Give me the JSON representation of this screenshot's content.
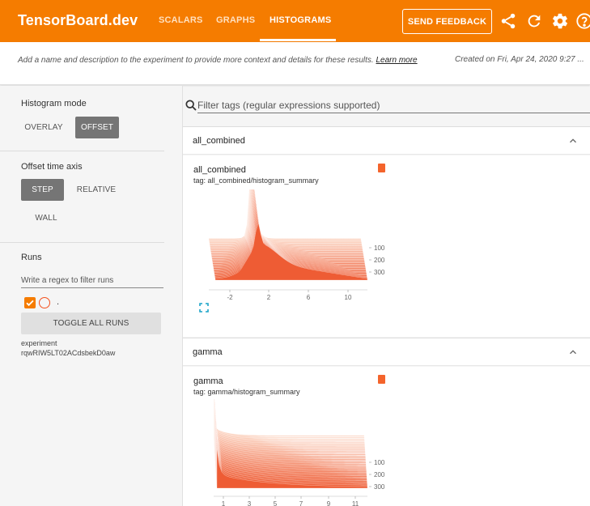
{
  "header": {
    "brand": "TensorBoard.dev",
    "tabs": [
      {
        "label": "SCALARS",
        "active": false
      },
      {
        "label": "GRAPHS",
        "active": false
      },
      {
        "label": "HISTOGRAMS",
        "active": true
      }
    ],
    "feedback_label": "SEND FEEDBACK",
    "icons": [
      "share-icon",
      "refresh-icon",
      "settings-icon",
      "help-icon"
    ],
    "accent_color": "#f57c00"
  },
  "description": {
    "text": "Add a name and description to the experiment to provide more context and details for these results.",
    "link_label": "Learn more",
    "created": "Created on Fri, Apr 24, 2020 9:27 ..."
  },
  "sidebar": {
    "histogram_mode": {
      "label": "Histogram mode",
      "options": [
        "OVERLAY",
        "OFFSET"
      ],
      "selected": "OFFSET"
    },
    "offset_axis": {
      "label": "Offset time axis",
      "options": [
        "STEP",
        "RELATIVE",
        "WALL"
      ],
      "selected": "STEP"
    },
    "runs": {
      "label": "Runs",
      "filter_placeholder": "Write a regex to filter runs",
      "items": [
        {
          "name": ".",
          "checked": true,
          "color": "#f4511e"
        }
      ],
      "toggle_all_label": "TOGGLE ALL RUNS",
      "experiment_label": "experiment",
      "experiment_id": "rqwRIW5LT02ACdsbekD0aw"
    }
  },
  "main": {
    "filter_placeholder": "Filter tags (regular expressions supported)",
    "categories": [
      {
        "name": "all_combined",
        "card": {
          "title": "all_combined",
          "tag": "tag: all_combined/histogram_summary",
          "y_ticks": [
            "100",
            "200",
            "300"
          ],
          "x_ticks": [
            "-2",
            "2",
            "6",
            "10"
          ]
        }
      },
      {
        "name": "gamma",
        "card": {
          "title": "gamma",
          "tag": "tag: gamma/histogram_summary",
          "y_ticks": [
            "100",
            "200",
            "300"
          ],
          "x_ticks": [
            "1",
            "3",
            "5",
            "7",
            "9",
            "11"
          ]
        }
      }
    ]
  }
}
